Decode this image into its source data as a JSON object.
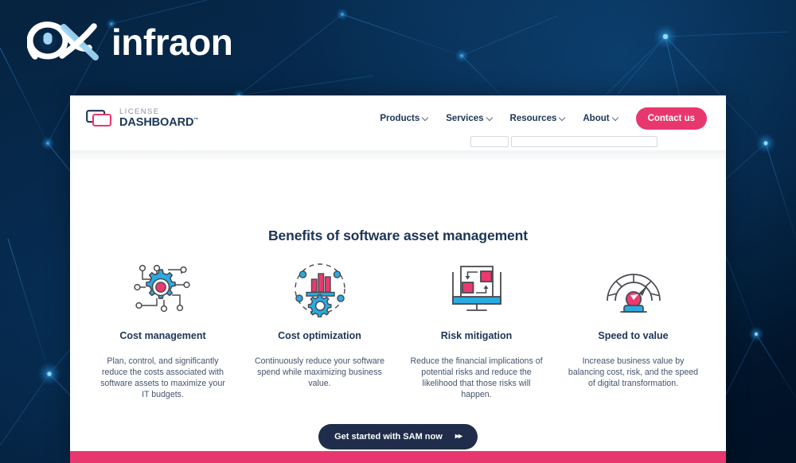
{
  "brand": {
    "name": "infraon",
    "logo_icon": "infraon-eye-ribbon-logo"
  },
  "site": {
    "logo": {
      "icon": "license-dashboard-rectangles-icon",
      "line1": "LICENSE",
      "line2": "DASHBOARD",
      "trademark": "™"
    },
    "nav": [
      {
        "label": "Products",
        "icon": "chevron-down-icon"
      },
      {
        "label": "Services",
        "icon": "chevron-down-icon"
      },
      {
        "label": "Resources",
        "icon": "chevron-down-icon"
      },
      {
        "label": "About",
        "icon": "chevron-down-icon"
      }
    ],
    "contact_button": "Contact us"
  },
  "main": {
    "section_title": "Benefits of software asset management",
    "cards": [
      {
        "icon": "gear-circuit-nodes-icon",
        "title": "Cost management",
        "body": "Plan, control, and significantly reduce the costs associated with software assets to maximize your IT budgets."
      },
      {
        "icon": "bar-chart-gear-icon",
        "title": "Cost optimization",
        "body": "Continuously reduce your software spend while maximizing business value."
      },
      {
        "icon": "monitor-workflow-icon",
        "title": "Risk mitigation",
        "body": "Reduce the financial implications of potential risks and reduce the likelihood that those risks will happen."
      },
      {
        "icon": "speedometer-gauge-icon",
        "title": "Speed to value",
        "body": "Increase business value by balancing cost, risk, and the speed of digital transformation."
      }
    ],
    "cta": {
      "label": "Get started with SAM now",
      "arrows": "▸▸",
      "icon": "double-chevron-right-icon"
    }
  },
  "colors": {
    "background_navy": "#032040",
    "brand_pink": "#e8376f",
    "heading_navy": "#1d3557",
    "icon_blue": "#29abe2",
    "icon_pink": "#ea3a6e",
    "icon_stroke": "#4a4a52",
    "cta_navy": "#1f2d4a",
    "body_text": "#45546b"
  }
}
